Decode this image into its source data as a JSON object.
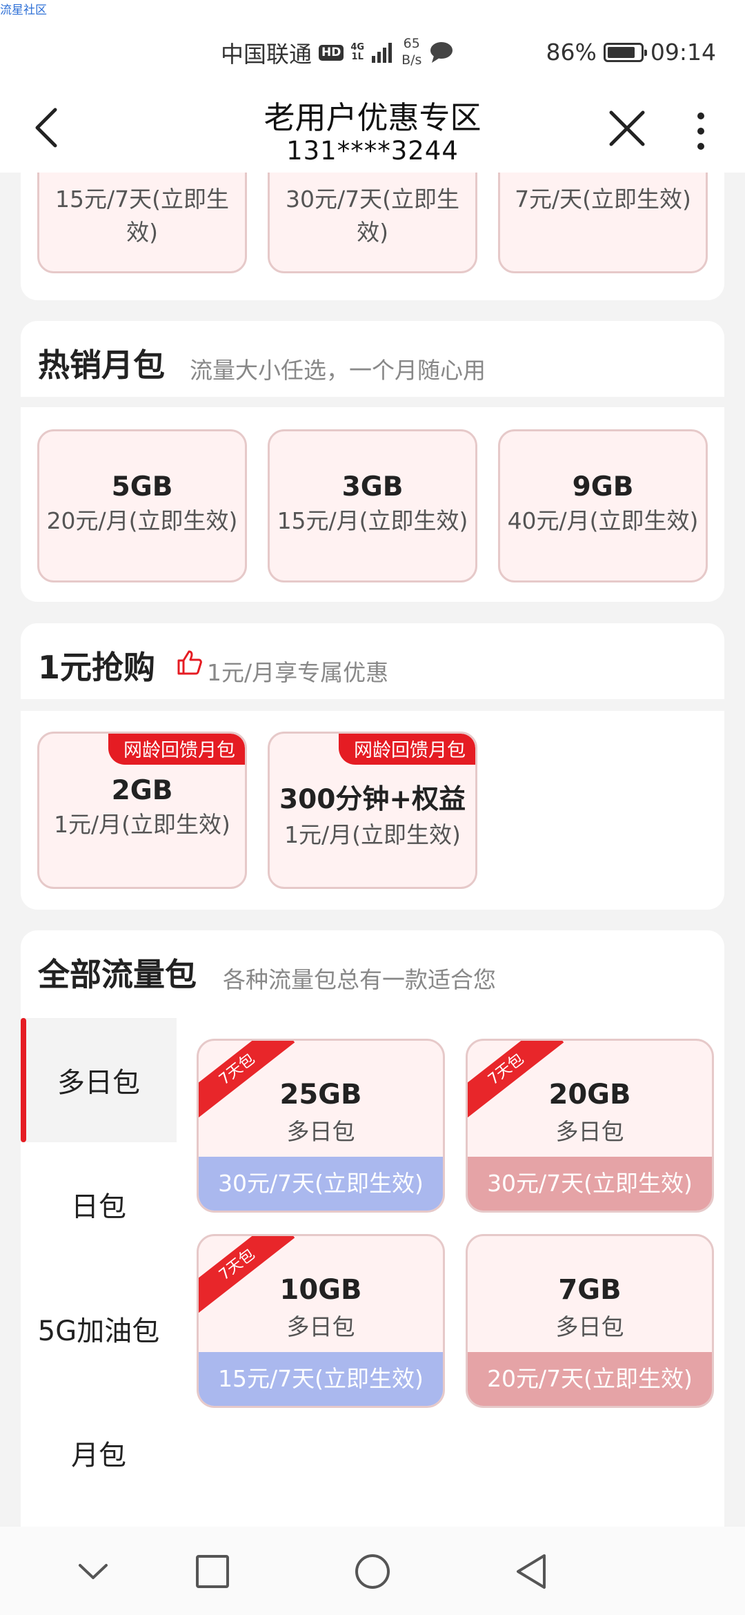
{
  "watermark": "流星社区",
  "status": {
    "carrier": "中国联通",
    "hd": "HD",
    "network_top": "4G",
    "network_bottom": "1L",
    "speed_value": "65",
    "speed_unit": "B/s",
    "battery_text": "86%",
    "battery_level": 0.86,
    "time": "09:14"
  },
  "header": {
    "title": "老用户优惠专区",
    "subtitle": "131****3244"
  },
  "top_partial": {
    "items": [
      {
        "price": "15元/7天(立即生效)"
      },
      {
        "price": "30元/7天(立即生效)"
      },
      {
        "price": "7元/天(立即生效)"
      }
    ]
  },
  "hot_monthly": {
    "title": "热销月包",
    "subtitle": "流量大小任选，一个月随心用",
    "items": [
      {
        "gb": "5GB",
        "price": "20元/月(立即生效)"
      },
      {
        "gb": "3GB",
        "price": "15元/月(立即生效)"
      },
      {
        "gb": "9GB",
        "price": "40元/月(立即生效)"
      }
    ]
  },
  "one_yuan": {
    "title": "1元抢购",
    "subtitle": "1元/月享专属优惠",
    "items": [
      {
        "tag": "网龄回馈月包",
        "gb": "2GB",
        "price": "1元/月(立即生效)"
      },
      {
        "tag": "网龄回馈月包",
        "gb": "300分钟+权益",
        "price": "1元/月(立即生效)"
      }
    ]
  },
  "all_packages": {
    "title": "全部流量包",
    "subtitle": "各种流量包总有一款适合您",
    "menu": [
      {
        "label": "多日包"
      },
      {
        "label": "日包"
      },
      {
        "label": "5G加油包"
      },
      {
        "label": "月包"
      }
    ],
    "items": [
      {
        "ribbon": "7天包",
        "gb": "25GB",
        "kind": "多日包",
        "price": "30元/7天(立即生效)"
      },
      {
        "ribbon": "7天包",
        "gb": "20GB",
        "kind": "多日包",
        "price": "30元/7天(立即生效)"
      },
      {
        "ribbon": "7天包",
        "gb": "10GB",
        "kind": "多日包",
        "price": "15元/7天(立即生效)"
      },
      {
        "ribbon": "",
        "gb": "7GB",
        "kind": "多日包",
        "price": "20元/7天(立即生效)"
      }
    ]
  },
  "colors": {
    "accent_red": "#e51c23",
    "card_pink": "#fff2f2",
    "price_blue": "#aab8ee",
    "price_pink": "#e5a3a6"
  }
}
